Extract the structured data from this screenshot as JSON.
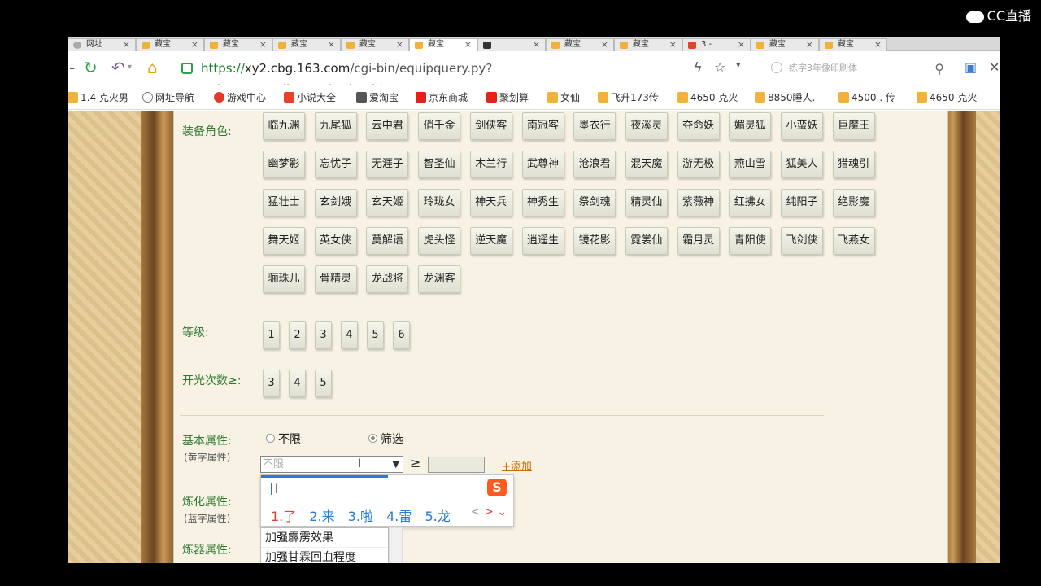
{
  "watermark": {
    "text": "CC直播"
  },
  "tabs": [
    {
      "label": "网址"
    },
    {
      "label": "藏宝"
    },
    {
      "label": "藏宝"
    },
    {
      "label": "藏宝"
    },
    {
      "label": "藏宝"
    },
    {
      "label": "藏宝"
    },
    {
      "label": ""
    },
    {
      "label": "藏宝"
    },
    {
      "label": "藏宝"
    },
    {
      "label": "3 -"
    },
    {
      "label": "藏宝"
    },
    {
      "label": "藏宝"
    }
  ],
  "address": {
    "scheme": "https://",
    "host": "xy2.cbg.163.com",
    "path": "/cgi-bin/equipquery.py?act=show_overall_search_shenbing",
    "search_placeholder": "练字3年像印刷体"
  },
  "bookmarks": [
    "1.4 克火男",
    "网址导航",
    "游戏中心",
    "小说大全",
    "爱淘宝",
    "京东商城",
    "聚划算",
    "女仙",
    "飞升173传",
    "4650 克火",
    "8850睡人.",
    "4500 . 传",
    "4650 克火"
  ],
  "form": {
    "role_label": "装备角色:",
    "roles": [
      "临九渊",
      "九尾狐",
      "云中君",
      "俏千金",
      "剑侠客",
      "南冠客",
      "墨衣行",
      "夜溪灵",
      "夺命妖",
      "媚灵狐",
      "小蛮妖",
      "巨魔王",
      "幽梦影",
      "忘忧子",
      "无涯子",
      "智圣仙",
      "木兰行",
      "武尊神",
      "沧浪君",
      "混天魔",
      "游无极",
      "燕山雪",
      "狐美人",
      "猎魂引",
      "猛壮士",
      "玄剑娥",
      "玄天姬",
      "玲珑女",
      "神天兵",
      "神秀生",
      "祭剑魂",
      "精灵仙",
      "紫薇神",
      "红拂女",
      "纯阳子",
      "绝影魔",
      "舞天姬",
      "英女侠",
      "莫解语",
      "虎头怪",
      "逆天魔",
      "逍遥生",
      "镜花影",
      "霓裳仙",
      "霜月灵",
      "青阳使",
      "飞剑侠",
      "飞燕女",
      "骊珠儿",
      "骨精灵",
      "龙战将",
      "龙渊客"
    ],
    "level_label": "等级:",
    "levels": [
      "1",
      "2",
      "3",
      "4",
      "5",
      "6"
    ],
    "open_label": "开光次数≥:",
    "opens": [
      "3",
      "4",
      "5"
    ],
    "base_attr_label": "基本属性:",
    "base_attr_sub": "(黄字属性)",
    "radio_unlimited": "不限",
    "radio_filter": "筛选",
    "select_value": "不限",
    "gte": "≥",
    "add_link": "+添加",
    "refine_label": "炼化属性:",
    "refine_sub": "(蓝字属性)",
    "forge_label": "炼器属性:"
  },
  "ime": {
    "composition": "l",
    "logo": "S",
    "candidates": [
      "1.了",
      "2.来",
      "3.啦",
      "4.雷",
      "5.龙"
    ],
    "prev": "<",
    "next": ">",
    "more": "⌄"
  },
  "dropdown": {
    "items": [
      "加强霹雳效果",
      "加强甘霖回血程度"
    ]
  },
  "colors": {
    "label_green": "#2f7a32",
    "link_orange": "#c07000",
    "ime_blue": "#2a7ad8",
    "ime_red": "#e0443a"
  }
}
